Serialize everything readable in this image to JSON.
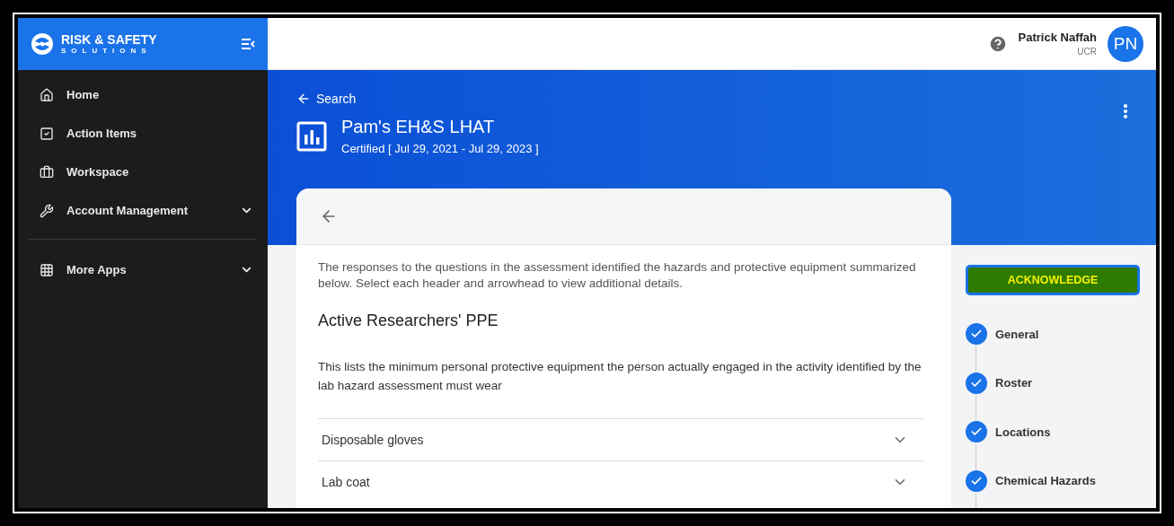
{
  "brand": {
    "name": "RISK & SAFETY",
    "tagline": "SOLUTIONS"
  },
  "sidebar": {
    "items": [
      {
        "label": "Home",
        "kind": "link"
      },
      {
        "label": "Action Items",
        "kind": "link"
      },
      {
        "label": "Workspace",
        "kind": "link"
      },
      {
        "label": "Account Management",
        "kind": "group"
      }
    ],
    "more": {
      "label": "More Apps",
      "kind": "group"
    }
  },
  "user": {
    "name": "Patrick Naffah",
    "org": "UCR",
    "initials": "PN"
  },
  "header": {
    "back": "Search",
    "title": "Pam's EH&S LHAT",
    "subtitle": "Certified [ Jul 29, 2021 - Jul 29, 2023 ]"
  },
  "card": {
    "intro": "The responses to the questions in the assessment identified the hazards and protective equipment summarized below. Select each header and arrowhead to view additional details.",
    "section_title": "Active Researchers' PPE",
    "section_text": "This lists the minimum personal protective equipment the person actually engaged in the activity identified by the lab hazard assessment must wear",
    "items": [
      {
        "label": "Disposable gloves",
        "expanded": false
      },
      {
        "label": "Lab coat",
        "expanded": false
      }
    ]
  },
  "acknowledge": "ACKNOWLEDGE",
  "steps": [
    {
      "label": "General",
      "completed": true
    },
    {
      "label": "Roster",
      "completed": true
    },
    {
      "label": "Locations",
      "completed": true
    },
    {
      "label": "Chemical Hazards",
      "completed": true
    }
  ]
}
